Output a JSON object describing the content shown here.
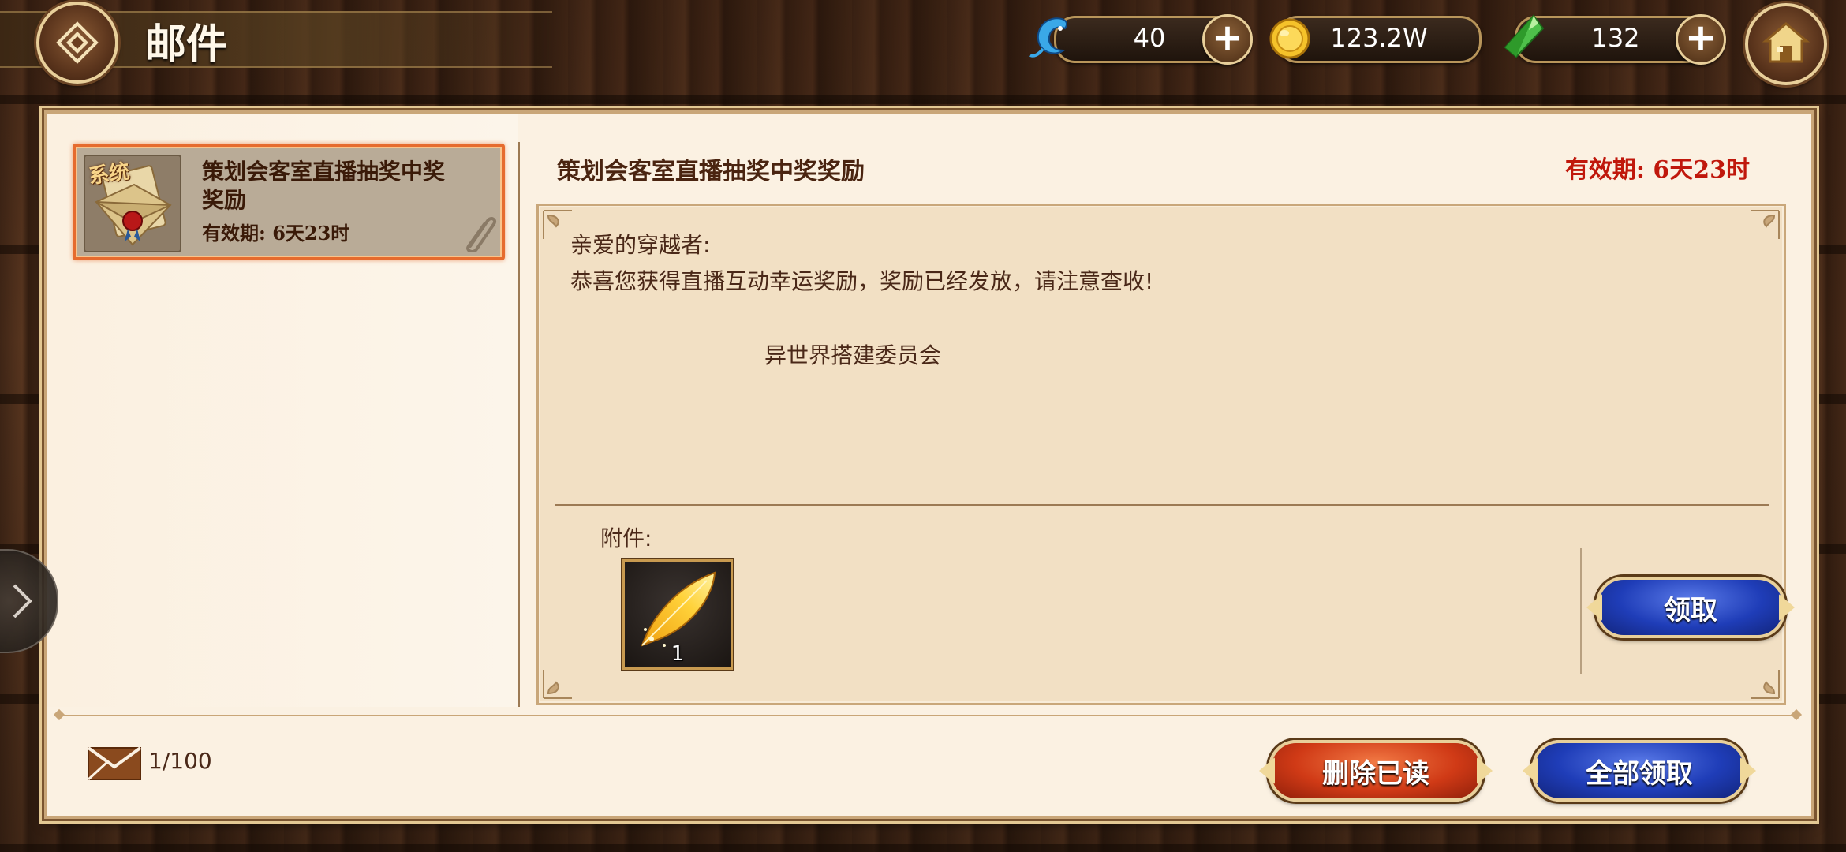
{
  "header": {
    "title": "邮件",
    "back_icon": "back-diamond-icon",
    "home_icon": "home-icon"
  },
  "resources": [
    {
      "name": "blue-dragon-currency",
      "icon": "blue-dragon-icon",
      "value": "40",
      "has_plus": true
    },
    {
      "name": "gold-coin-currency",
      "icon": "gold-coin-icon",
      "value": "123.2W",
      "has_plus": false
    },
    {
      "name": "green-gem-currency",
      "icon": "green-gem-icon",
      "value": "132",
      "has_plus": true
    }
  ],
  "mail_list": [
    {
      "tag": "系统",
      "title": "策划会客室直播抽奖中奖奖励",
      "expire": "有效期:   6天23时",
      "selected": true,
      "has_attachment": true
    }
  ],
  "detail": {
    "title": "策划会客室直播抽奖中奖奖励",
    "expire": "有效期:  6天23时",
    "greeting": "亲爱的穿越者:",
    "body": "恭喜您获得直播互动幸运奖励，奖励已经发放，请注意查收!",
    "signature": "异世界搭建委员会",
    "attachments_label": "附件:",
    "attachments": [
      {
        "icon": "golden-feather-icon",
        "count": "1"
      }
    ],
    "claim_label": "领取"
  },
  "footer": {
    "mail_count": "1/100",
    "delete_read_label": "删除已读",
    "claim_all_label": "全部领取"
  },
  "colors": {
    "expire_red": "#c0180c",
    "selected_border": "#e66b2e",
    "button_blue": "#1f3db8",
    "button_red": "#d03a16"
  }
}
